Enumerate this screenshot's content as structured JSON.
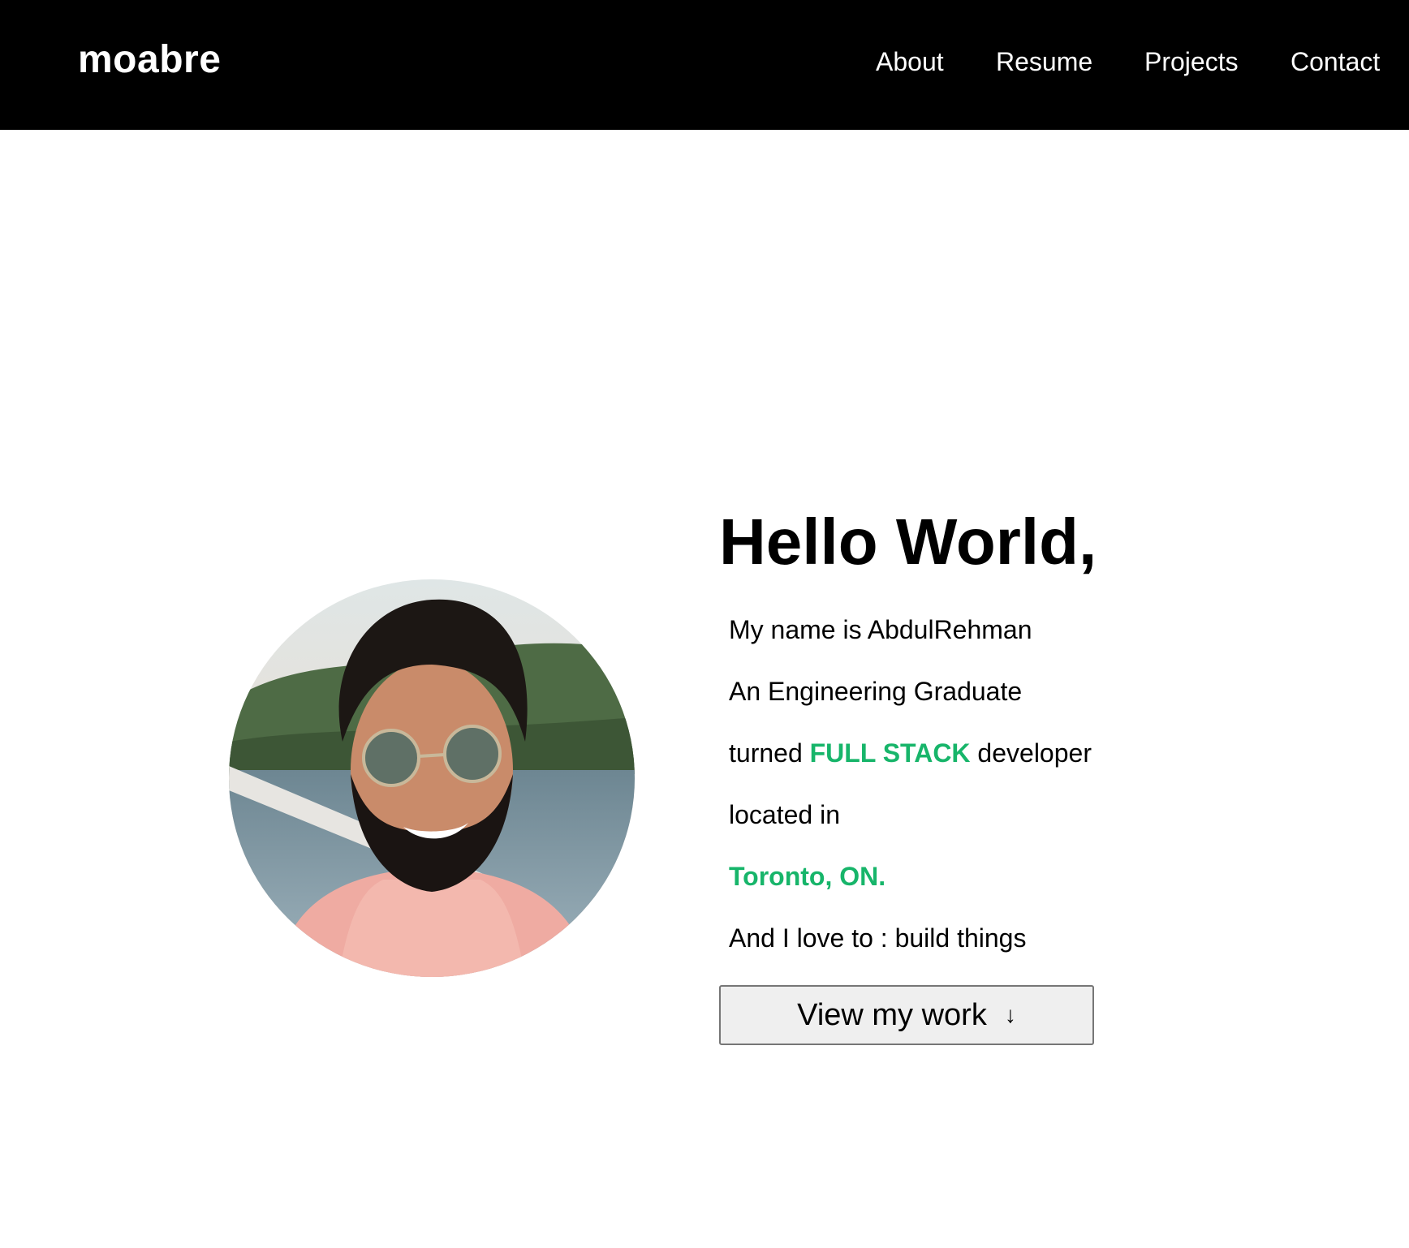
{
  "header": {
    "brand": "moabre",
    "nav": [
      "About",
      "Resume",
      "Projects",
      "Contact"
    ]
  },
  "hero": {
    "greeting": "Hello World,",
    "name_line": "My name is AbdulRehman",
    "degree_line": "An Engineering Graduate",
    "role_prefix": "turned",
    "role_highlight": "FULL STACK",
    "role_suffix": "developer",
    "location_prefix": "located in",
    "location": "Toronto, ON.",
    "love_line": "And I love to : build things",
    "cta_label": "View my work",
    "cta_icon": "arrow-down-icon"
  },
  "colors": {
    "header_bg": "#000000",
    "accent": "#17b56a"
  }
}
